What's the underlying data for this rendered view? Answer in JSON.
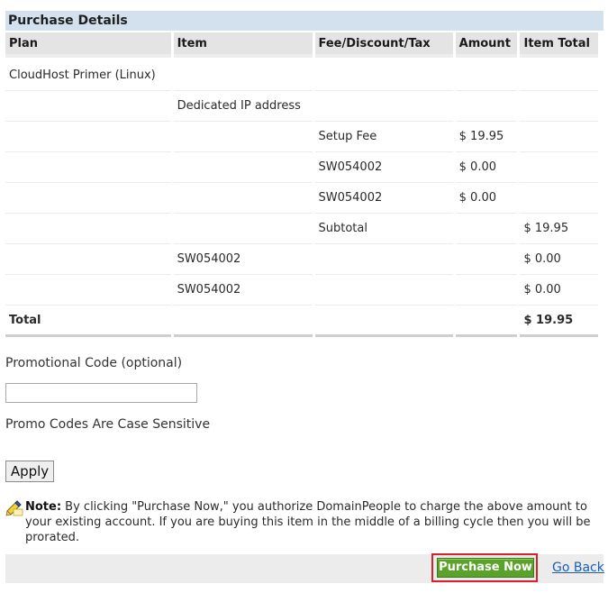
{
  "purchase": {
    "title": "Purchase Details",
    "columns": [
      "Plan",
      "Item",
      "Fee/Discount/Tax",
      "Amount",
      "Item Total"
    ],
    "rows": [
      {
        "plan": "CloudHost Primer (Linux)",
        "item": "",
        "fee": "",
        "amount": "",
        "total": ""
      },
      {
        "plan": "",
        "item": "Dedicated IP address",
        "fee": "",
        "amount": "",
        "total": ""
      },
      {
        "plan": "",
        "item": "",
        "fee": "Setup Fee",
        "amount": "$ 19.95",
        "total": ""
      },
      {
        "plan": "",
        "item": "",
        "fee": "SW054002",
        "amount": "$ 0.00",
        "total": ""
      },
      {
        "plan": "",
        "item": "",
        "fee": "SW054002",
        "amount": "$ 0.00",
        "total": ""
      },
      {
        "plan": "",
        "item": "",
        "fee": "Subtotal",
        "amount": "",
        "total": "$ 19.95"
      },
      {
        "plan": "",
        "item": "SW054002",
        "fee": "",
        "amount": "",
        "total": "$ 0.00"
      },
      {
        "plan": "",
        "item": "SW054002",
        "fee": "",
        "amount": "",
        "total": "$ 0.00"
      }
    ],
    "total_label": "Total",
    "total_value": "$ 19.95"
  },
  "promo": {
    "label": "Promotional Code (optional)",
    "value": "",
    "case_note": "Promo Codes Are Case Sensitive",
    "apply_label": "Apply"
  },
  "note": {
    "icon": "pencil-note-icon",
    "label": "Note:",
    "text": " By clicking \"Purchase Now,\" you authorize DomainPeople to charge the above amount to your existing account. If you are buying this item in the middle of a billing cycle then you will be prorated."
  },
  "actions": {
    "purchase_label": "Purchase Now",
    "back_label": "Go Back"
  },
  "colors": {
    "header_bg": "#d3e1ef",
    "purchase_green": "#5aa22a",
    "highlight_red": "#d8202e",
    "link_blue": "#1a5fb4"
  }
}
